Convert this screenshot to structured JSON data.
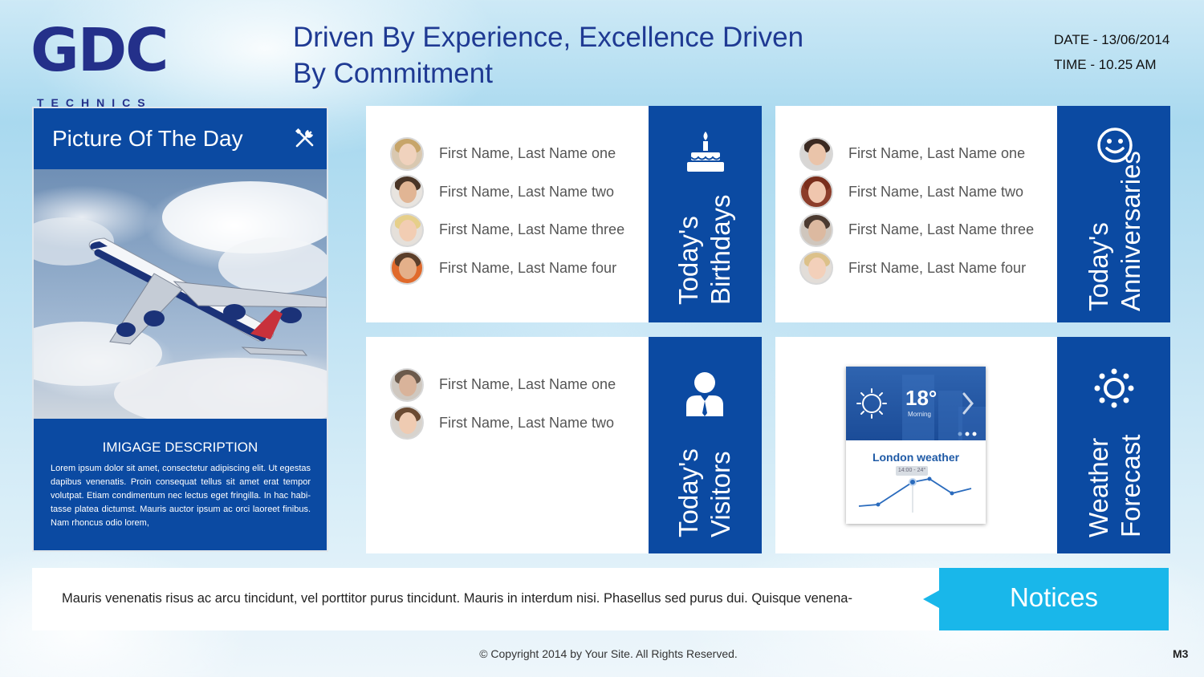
{
  "header": {
    "logo_main": "GDC",
    "logo_sub": "TECHNICS",
    "tagline_line1": "Driven By Experience, Excellence Driven",
    "tagline_line2": "By Commitment",
    "date": "DATE - 13/06/2014",
    "time": "TIME - 10.25 AM"
  },
  "picture_of_the_day": {
    "title": "Picture Of The Day",
    "description_title": "IMIGAGE DESCRIPTION",
    "description_text": "Lorem ipsum dolor sit amet, consectetur adipiscing elit. Ut egestas dapibus venenatis. Proin consequat tellus sit amet erat tempor volutpat. Etiam condimentum nec lectus eget fringilla. In hac habi-tasse platea dictumst. Mauris auctor ipsum ac orci laoreet finibus. Nam rhoncus odio lorem,"
  },
  "birthdays": {
    "label_line1": "Today's",
    "label_line2": "Birthdays",
    "people": [
      {
        "name": "First Name, Last Name one"
      },
      {
        "name": "First Name, Last Name two"
      },
      {
        "name": "First Name, Last Name three"
      },
      {
        "name": "First Name, Last Name four"
      }
    ]
  },
  "anniversaries": {
    "label_line1": "Today's",
    "label_line2": "Anniversaries",
    "people": [
      {
        "name": "First Name, Last Name one"
      },
      {
        "name": "First Name, Last Name two"
      },
      {
        "name": "First Name, Last Name three"
      },
      {
        "name": "First Name, Last Name four"
      }
    ]
  },
  "visitors": {
    "label_line1": "Today's",
    "label_line2": "Visitors",
    "people": [
      {
        "name": "First Name, Last Name one"
      },
      {
        "name": "First Name, Last Name two"
      }
    ]
  },
  "weather": {
    "label_line1": "Weather",
    "label_line2": "Forecast",
    "temperature": "18°",
    "period": "Morning",
    "city": "London weather",
    "range": "14:00 - 24°"
  },
  "notices": {
    "text": "Mauris venenatis risus ac arcu tincidunt, vel porttitor purus tincidunt. Mauris in interdum nisi. Phasellus sed purus dui. Quisque venena-",
    "label": "Notices"
  },
  "footer": {
    "copyright": "© Copyright 2014 by Your Site. All Rights Reserved.",
    "page_id": "M3"
  },
  "colors": {
    "primary_blue": "#0b4aa2",
    "accent_cyan": "#19b7ea",
    "logo_navy": "#24308a"
  },
  "icons": [
    "tools-icon",
    "birthday-cake-icon",
    "smiley-icon",
    "visitor-icon",
    "sun-icon",
    "chevron-right-icon"
  ]
}
